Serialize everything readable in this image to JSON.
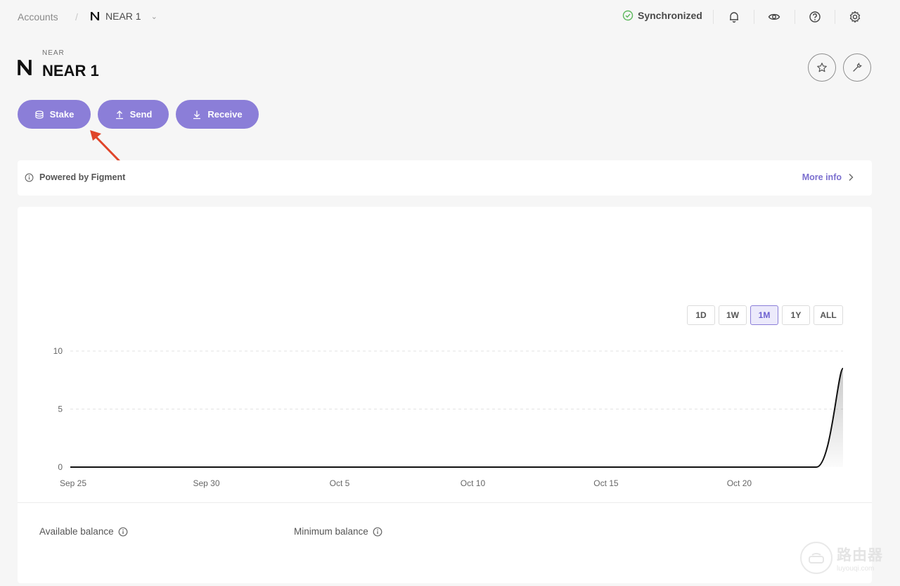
{
  "breadcrumb": {
    "accounts": "Accounts",
    "separator": "/",
    "account": "NEAR 1"
  },
  "status": {
    "label": "Synchronized",
    "color": "#5cb85c"
  },
  "header": {
    "ticker": "NEAR",
    "title": "NEAR 1"
  },
  "actions": {
    "stake": "Stake",
    "send": "Send",
    "receive": "Receive",
    "color": "#8b7ed8"
  },
  "info": {
    "powered_by": "Powered by Figment",
    "more_info": "More info"
  },
  "chart": {
    "range_buttons": [
      "1D",
      "1W",
      "1M",
      "1Y",
      "ALL"
    ],
    "active_range": "1M"
  },
  "chart_data": {
    "type": "area",
    "title": "",
    "xlabel": "",
    "ylabel": "",
    "ylim": [
      0,
      10
    ],
    "y_ticks": [
      "0",
      "5",
      "10"
    ],
    "x_ticks": [
      "Sep 25",
      "Sep 30",
      "Oct 5",
      "Oct 10",
      "Oct 15",
      "Oct 20"
    ],
    "grid": true,
    "series": [
      {
        "x": [
          "Sep 25",
          "Sep 30",
          "Oct 5",
          "Oct 10",
          "Oct 15",
          "Oct 20",
          "Oct 22",
          "Oct 23",
          "Oct 24"
        ],
        "values": [
          0,
          0,
          0,
          0,
          0,
          0,
          0,
          0,
          8.5
        ]
      }
    ]
  },
  "balances": {
    "available": "Available balance",
    "minimum": "Minimum balance"
  },
  "watermark": {
    "cn": "路由器",
    "url": "luyouqi.com"
  },
  "icons": {
    "near_logo": "near-logo-icon",
    "check": "check-circle-icon",
    "bell": "bell-icon",
    "eye": "eye-icon",
    "help": "help-icon",
    "settings": "gear-icon",
    "star": "star-icon",
    "wrench": "wrench-icon",
    "info": "info-icon",
    "chevron": "chevron-right-icon"
  }
}
